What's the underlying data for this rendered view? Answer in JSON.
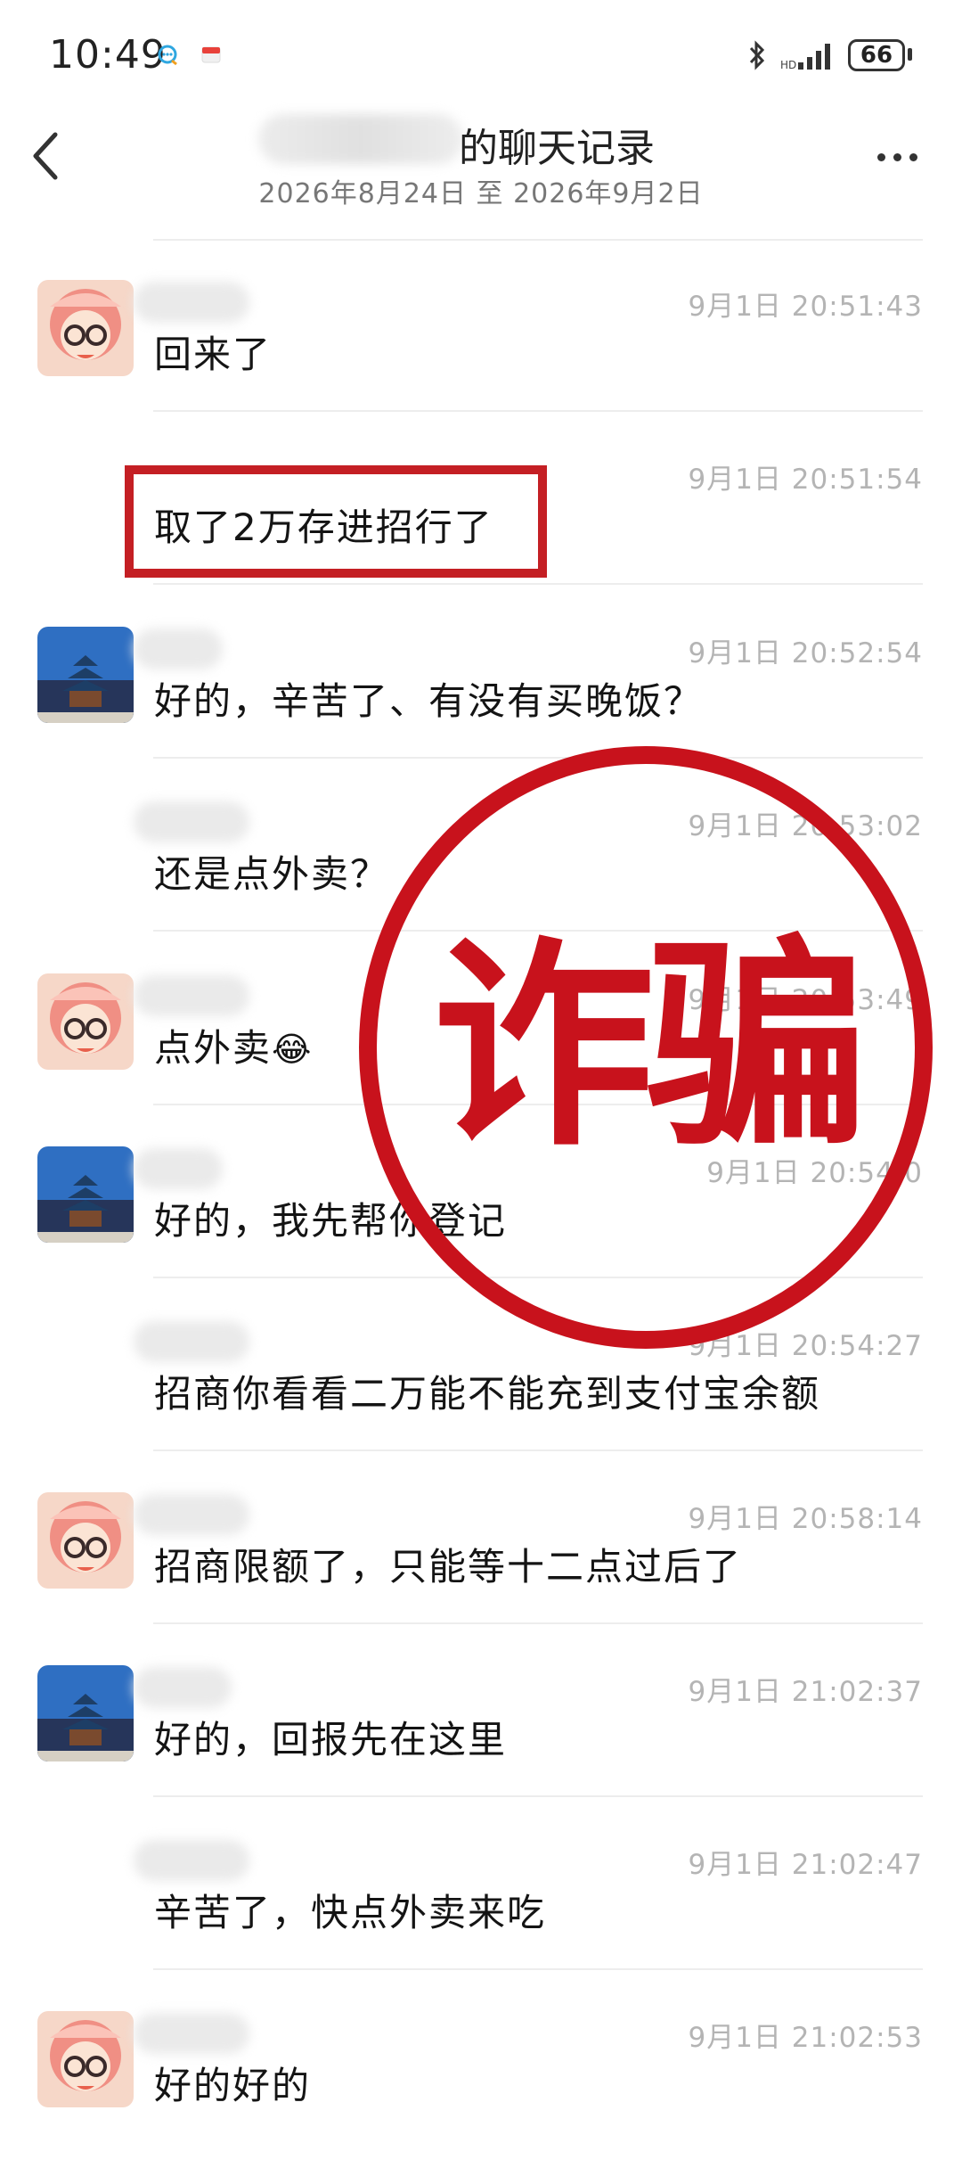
{
  "status_bar": {
    "time": "10:49",
    "battery": "66",
    "icons": [
      "chat-notification-icon",
      "app-notification-icon",
      "bluetooth-icon",
      "signal-icon",
      "battery-icon"
    ]
  },
  "header": {
    "title": "的聊天记录",
    "subtitle": "2026年8月24日 至 2026年9月2日",
    "back_icon": "chevron-left-icon",
    "more_icon": "more-dots-icon"
  },
  "messages": [
    {
      "sender": "female-avatar",
      "time": "9月1日 20:51:43",
      "text": "回来了"
    },
    {
      "sender": "female-avatar",
      "time": "9月1日 20:51:54",
      "text": "取了2万存进招行了",
      "highlighted": true
    },
    {
      "sender": "temple-avatar",
      "time": "9月1日 20:52:54",
      "text": "好的，辛苦了、有没有买晚饭？"
    },
    {
      "sender": "temple-avatar",
      "time": "9月1日 20:53:02",
      "text": "还是点外卖？"
    },
    {
      "sender": "female-avatar",
      "time": "9月1日 20:53:49",
      "text": "点外卖",
      "emoji": "😂"
    },
    {
      "sender": "temple-avatar",
      "time": "9月1日 20:54:0",
      "text": "好的，我先帮你登记"
    },
    {
      "sender": "temple-avatar",
      "time": "9月1日 20:54:27",
      "text": "招商你看看二万能不能充到支付宝余额"
    },
    {
      "sender": "female-avatar",
      "time": "9月1日 20:58:14",
      "text": "招商限额了，只能等十二点过后了"
    },
    {
      "sender": "temple-avatar",
      "time": "9月1日 21:02:37",
      "text": "好的，回报先在这里"
    },
    {
      "sender": "temple-avatar",
      "time": "9月1日 21:02:47",
      "text": "辛苦了，快点外卖来吃"
    },
    {
      "sender": "female-avatar",
      "time": "9月1日 21:02:53",
      "text": "好的好的"
    }
  ],
  "stamp": {
    "text": "诈骗",
    "color": "#c8121c"
  },
  "colors": {
    "highlight_box": "#c41f24",
    "timestamp": "#b4b4b4"
  }
}
